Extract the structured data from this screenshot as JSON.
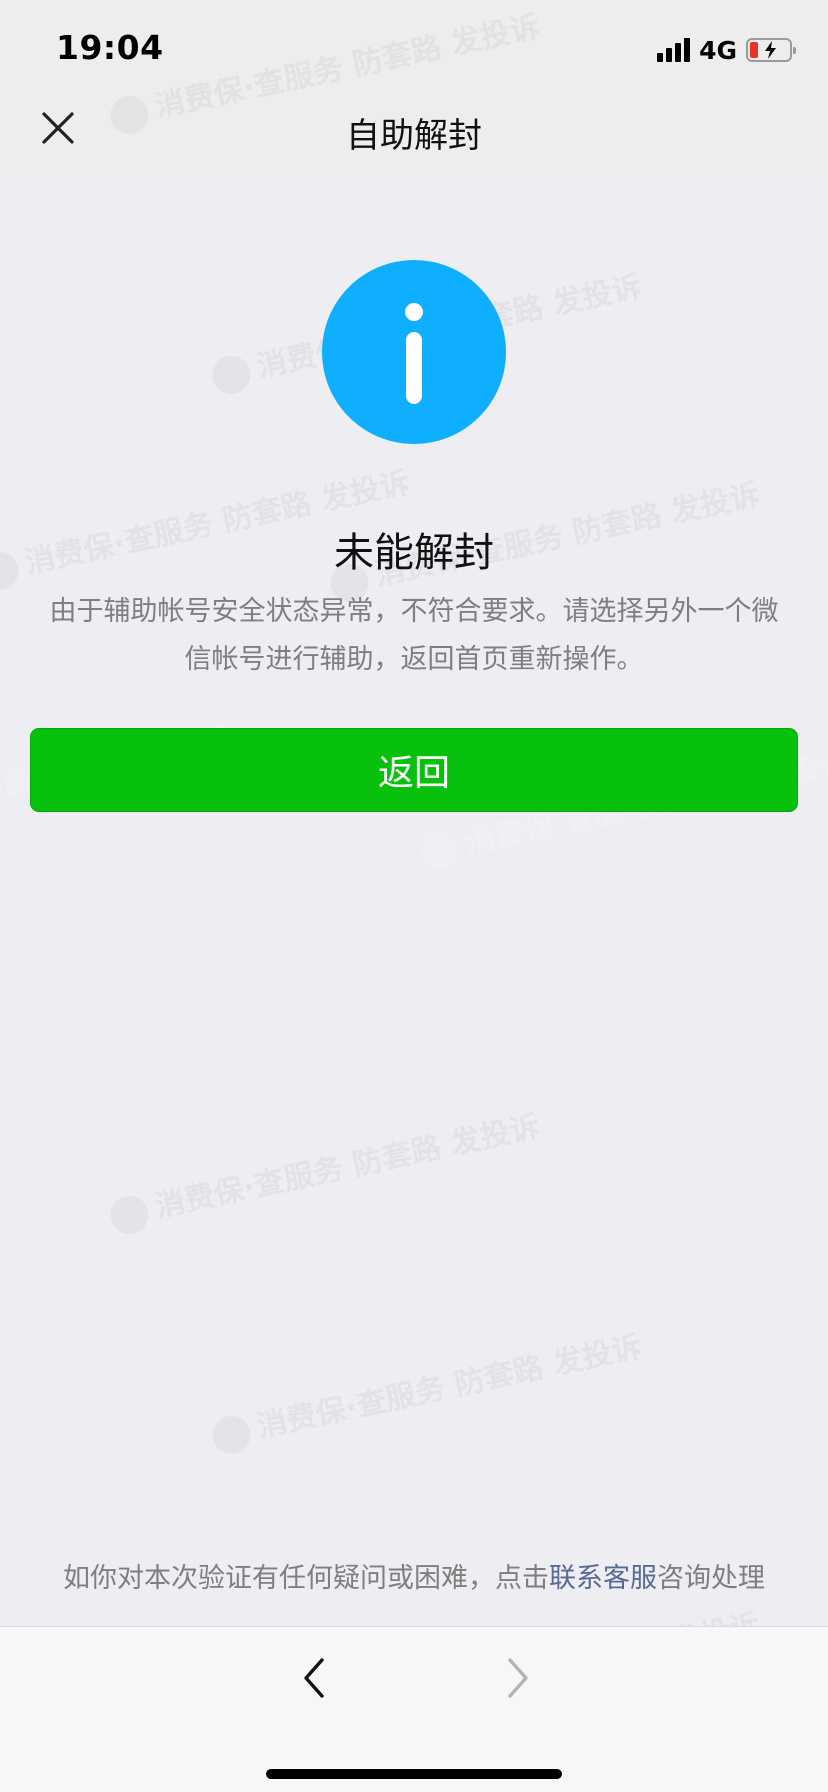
{
  "status_bar": {
    "time": "19:04",
    "network": "4G"
  },
  "header": {
    "title": "自助解封",
    "close_icon": "close-icon"
  },
  "result": {
    "icon": "info-icon",
    "icon_color": "#10aeff",
    "title": "未能解封",
    "description": "由于辅助帐号安全状态异常，不符合要求。请选择另外一个微信帐号进行辅助，返回首页重新操作。"
  },
  "actions": {
    "back_label": "返回",
    "button_color": "#08c10d"
  },
  "footer": {
    "help_prefix": "如你对本次验证有任何疑问或困难，点击",
    "help_link": "联系客服",
    "help_suffix": "咨询处理",
    "link_color": "#576b95"
  },
  "bottom_nav": {
    "back_icon": "chevron-left-icon",
    "forward_icon": "chevron-right-icon"
  },
  "watermark": {
    "brand": "消费保",
    "slogan": "·查服务 防套路 发投诉"
  }
}
